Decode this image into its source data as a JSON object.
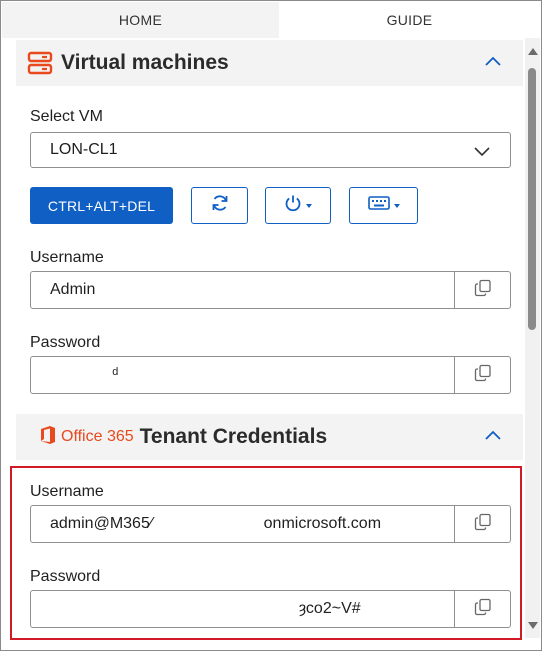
{
  "tabs": {
    "home": "HOME",
    "guide": "GUIDE"
  },
  "vm_section": {
    "title": "Virtual machines",
    "icon": "server-stack-icon",
    "select_label": "Select VM",
    "selected_vm": "LON-CL1",
    "ctrl_alt_del_label": "CTRL+ALT+DEL",
    "username_label": "Username",
    "username_value": "Admin",
    "password_label": "Password",
    "password_value": "              ᵈ"
  },
  "tenant_section": {
    "brand": "Office 365",
    "title": "Tenant Credentials",
    "username_label": "Username",
    "username_value": "admin@M365⁄                         onmicrosoft.com",
    "password_label": "Password",
    "password_value": "                                                        ȝco2~V#"
  },
  "colors": {
    "accent": "#0f5fc5",
    "office_orange": "#e8491d",
    "highlight_red": "#d21a26",
    "header_bg": "#f3f3f3"
  }
}
